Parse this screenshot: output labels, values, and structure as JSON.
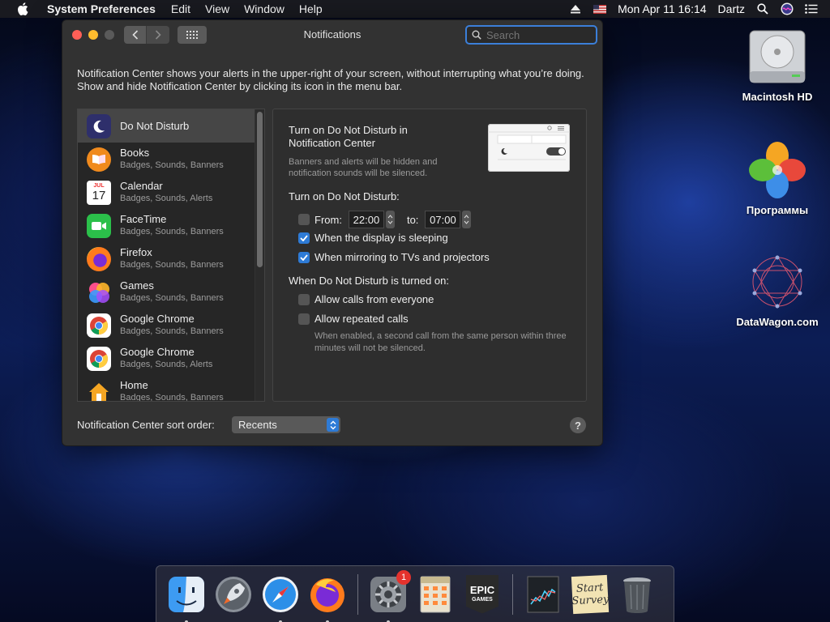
{
  "menubar": {
    "app_name": "System Preferences",
    "items": [
      "Edit",
      "View",
      "Window",
      "Help"
    ],
    "datetime": "Mon Apr 11  16:14",
    "user": "Dartz"
  },
  "desktop": {
    "icons": [
      {
        "label": "Macintosh HD"
      },
      {
        "label": "Программы"
      },
      {
        "label": "DataWagon.com"
      }
    ]
  },
  "window": {
    "title": "Notifications",
    "search_placeholder": "Search",
    "intro": "Notification Center shows your alerts in the upper-right of your screen, without interrupting what you’re doing. Show and hide Notification Center by clicking its icon in the menu bar.",
    "apps": [
      {
        "name": "Do Not Disturb",
        "subtitle": "",
        "selected": true
      },
      {
        "name": "Books",
        "subtitle": "Badges, Sounds, Banners"
      },
      {
        "name": "Calendar",
        "subtitle": "Badges, Sounds, Alerts"
      },
      {
        "name": "FaceTime",
        "subtitle": "Badges, Sounds, Banners"
      },
      {
        "name": "Firefox",
        "subtitle": "Badges, Sounds, Banners"
      },
      {
        "name": "Games",
        "subtitle": "Badges, Sounds, Banners"
      },
      {
        "name": "Google Chrome",
        "subtitle": "Badges, Sounds, Banners"
      },
      {
        "name": "Google Chrome",
        "subtitle": "Badges, Sounds, Alerts"
      },
      {
        "name": "Home",
        "subtitle": "Badges, Sounds, Banners"
      }
    ],
    "calendar_icon": {
      "month": "JUL",
      "day": "17"
    },
    "dnd": {
      "heading": "Turn on Do Not Disturb in Notification Center",
      "description": "Banners and alerts will be hidden and notification sounds will be silenced.",
      "turn_on_label": "Turn on Do Not Disturb:",
      "from_label": "From:",
      "from_time": "22:00",
      "to_label": "to:",
      "to_time": "07:00",
      "from_checked": false,
      "display_sleeping_label": "When the display is sleeping",
      "display_sleeping_checked": true,
      "mirroring_label": "When mirroring to TVs and projectors",
      "mirroring_checked": true,
      "when_on_label": "When Do Not Disturb is turned on:",
      "allow_calls_label": "Allow calls from everyone",
      "allow_calls_checked": false,
      "repeated_calls_label": "Allow repeated calls",
      "repeated_calls_checked": false,
      "repeated_note": "When enabled, a second call from the same person within three minutes will not be silenced."
    },
    "sort_label": "Notification Center sort order:",
    "sort_value": "Recents",
    "help": "?"
  },
  "dock": {
    "badge_system_prefs": "1",
    "epic_line1": "EPIC",
    "epic_line2": "GAMES",
    "survey_line1": "Start",
    "survey_line2": "Survey"
  },
  "colors": {
    "accent": "#2e7bd6",
    "window_bg": "#323232",
    "close": "#ff5f57",
    "minimize": "#febc2e"
  }
}
